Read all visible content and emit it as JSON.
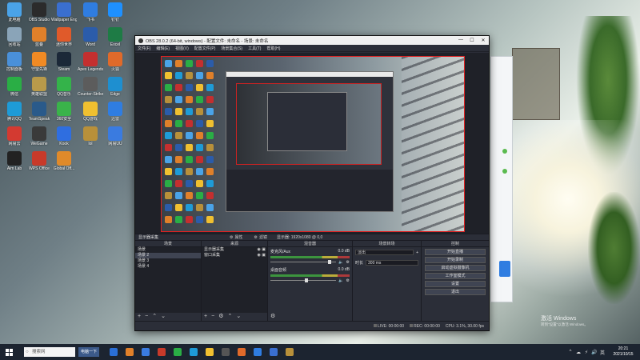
{
  "desktop": {
    "icons": [
      {
        "label": "此电脑",
        "color": "#4aa3e8"
      },
      {
        "label": "OBS Studio",
        "color": "#2b2b2b"
      },
      {
        "label": "Wallpaper Engine",
        "color": "#3a6fd0"
      },
      {
        "label": "飞书",
        "color": "#2f7de1"
      },
      {
        "label": "钉钉",
        "color": "#1e90ff"
      },
      {
        "label": "回收站",
        "color": "#8aa4b8"
      },
      {
        "label": "蓝叠",
        "color": "#e0802a"
      },
      {
        "label": "迷你世界",
        "color": "#e05a2a"
      },
      {
        "label": "Word",
        "color": "#2b5caa"
      },
      {
        "label": "Excel",
        "color": "#1e7b45"
      },
      {
        "label": "控制面板",
        "color": "#4a90d9"
      },
      {
        "label": "守望先锋",
        "color": "#f08a24"
      },
      {
        "label": "Steam",
        "color": "#1b2838"
      },
      {
        "label": "Apex Legends",
        "color": "#c42f2f"
      },
      {
        "label": "火狐",
        "color": "#e06a2a"
      },
      {
        "label": "微信",
        "color": "#2aae45"
      },
      {
        "label": "英雄联盟",
        "color": "#b89a4a"
      },
      {
        "label": "QQ音乐",
        "color": "#34b34a"
      },
      {
        "label": "Counter-Strike",
        "color": "#5c5c5c"
      },
      {
        "label": "Edge",
        "color": "#1e8fd0"
      },
      {
        "label": "腾讯QQ",
        "color": "#1e9bd7"
      },
      {
        "label": "TeamSpeak",
        "color": "#2a5a8a"
      },
      {
        "label": "360安全",
        "color": "#3ab34a"
      },
      {
        "label": "QQ游戏",
        "color": "#f0c030"
      },
      {
        "label": "迅雷",
        "color": "#2f7de1"
      },
      {
        "label": "网易云",
        "color": "#d33a31"
      },
      {
        "label": "WeGame",
        "color": "#3a3a3a"
      },
      {
        "label": "Kook",
        "color": "#2f6ee0"
      },
      {
        "label": "lol",
        "color": "#b8903a"
      },
      {
        "label": "网易UU",
        "color": "#3a7be0"
      },
      {
        "label": "Aim Lab",
        "color": "#222"
      },
      {
        "label": "WPS Office",
        "color": "#c83a2a"
      },
      {
        "label": "Global Off...",
        "color": "#e08a2a"
      }
    ],
    "watermark_line1": "激活 Windows",
    "watermark_line2": "转到\"设置\"以激活 Windows。"
  },
  "obs": {
    "title": "OBS 28.0.2 (64-bit, windows) - 配置文件: 未命名 - 场景: 未命名",
    "window_controls": [
      "—",
      "☐",
      "✕"
    ],
    "menu": [
      "文件(F)",
      "编辑(E)",
      "视图(V)",
      "配置文件(P)",
      "场景集合(S)",
      "工具(T)",
      "帮助(H)"
    ],
    "context_bar": {
      "source_label": "显示器采集",
      "properties_btn": "属性",
      "filters_btn": "滤镜",
      "display_info": "显示器: 1920x1080 @ 0,0"
    },
    "docks": {
      "scenes": {
        "title": "场景",
        "items": [
          "场景",
          "场景 2",
          "场景 3",
          "场景 4"
        ],
        "selected": 1
      },
      "sources": {
        "title": "来源",
        "items": [
          "显示器采集",
          "窗口采集"
        ]
      },
      "mixer": {
        "title": "混音器",
        "channels": [
          {
            "name": "桌面音频",
            "db": "0.0 dB"
          },
          {
            "name": "麦克风/Aux",
            "db": "0.0 dB"
          }
        ]
      },
      "transitions": {
        "title": "场景转场",
        "type": "淡出",
        "duration_label": "时长",
        "duration_value": "300 ms"
      },
      "controls": {
        "title": "控制",
        "buttons": [
          "开始直播",
          "开始录制",
          "启动虚拟摄像机",
          "工作室模式",
          "设置",
          "退出"
        ]
      }
    },
    "status": {
      "live": "LIVE: 00:00:00",
      "rec": "REC: 00:00:00",
      "cpu": "CPU: 3.1%, 30.00 fps"
    }
  },
  "taskbar": {
    "search_placeholder": "在这里输入你要搜索的内容",
    "search_text": "搜索网",
    "pill_label": "电脑一下",
    "tray_icons": [
      "^",
      "☁",
      "⚡",
      "🔊",
      "英"
    ],
    "time": "20:21",
    "date": "2021/10/15"
  }
}
